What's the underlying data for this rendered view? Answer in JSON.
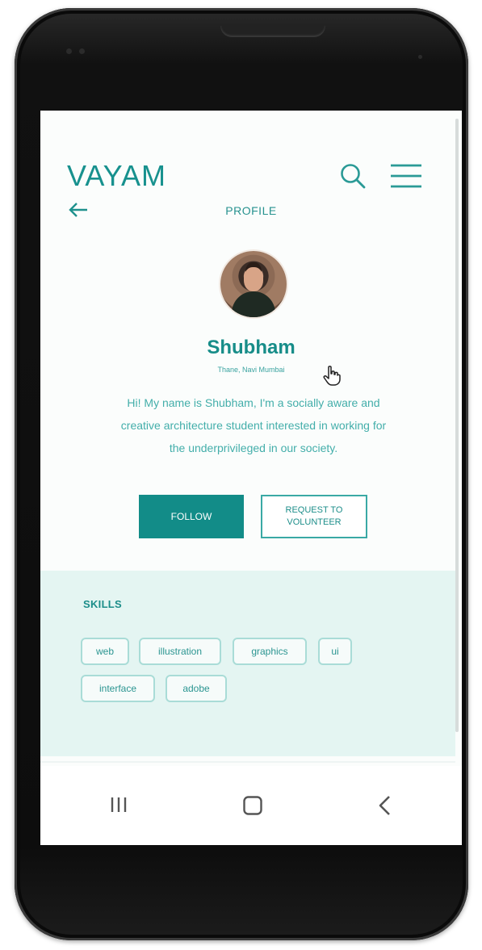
{
  "app": {
    "logo": "VAYAM",
    "page_title": "PROFILE"
  },
  "profile": {
    "name": "Shubham",
    "location": "Thane, Navi Mumbai",
    "bio_lines": [
      "Hi! My name is Shubham, I'm a socially aware and",
      "creative architecture student interested in working for",
      "the underprivileged in our society."
    ]
  },
  "actions": {
    "follow_label": "FOLLOW",
    "volunteer_label_line1": "REQUEST TO",
    "volunteer_label_line2": "VOLUNTEER"
  },
  "skills": {
    "heading": "SKILLS",
    "items": [
      "web",
      "illustration",
      "graphics",
      "ui",
      "interface",
      "adobe"
    ]
  },
  "colors": {
    "accent": "#128c88",
    "skills_bg": "#e4f5f2",
    "text_teal": "#43aeaa"
  },
  "icons": {
    "search": "search-icon",
    "menu": "hamburger-menu-icon",
    "back": "arrow-left-icon",
    "cursor": "hand-pointer-icon",
    "nav_recent": "recent-apps-icon",
    "nav_home": "home-icon",
    "nav_back": "chevron-left-icon"
  }
}
